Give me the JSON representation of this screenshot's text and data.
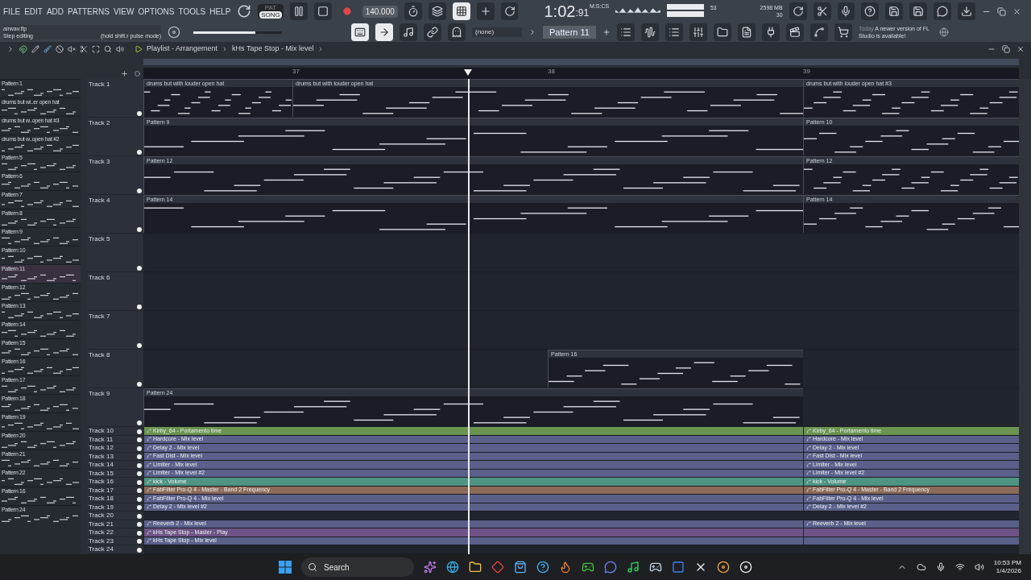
{
  "menu": [
    "FILE",
    "EDIT",
    "ADD",
    "PATTERNS",
    "VIEW",
    "OPTIONS",
    "TOOLS",
    "HELP"
  ],
  "mode": [
    {
      "label": "PAT",
      "selected": false
    },
    {
      "label": "SONG",
      "selected": true
    }
  ],
  "tempo": "140.000",
  "time": {
    "value": "1:02",
    "centiseconds": ":91",
    "unit": "M:S:CS"
  },
  "cpu": {
    "value": "53",
    "memory": "2598 MB",
    "polyphony": "30"
  },
  "hint": {
    "file": "airwav.flp",
    "mode": "Step editing",
    "tip": "(hold shift.r pulse mode)"
  },
  "master_volume": {
    "level": 0.7
  },
  "channel_target": "(none)",
  "pattern_selector": "Pattern 11",
  "news": {
    "date": "Today",
    "text": "A newer version of FL Studio is available!"
  },
  "playlist": {
    "title": "Playlist - Arrangement",
    "breadcrumb": "kHs Tape Stop - Mix level",
    "ruler": [
      "37",
      "38",
      "39"
    ],
    "playhead": {
      "level": 0.371
    },
    "patterns": [
      {
        "name": "Pattern 1",
        "selected": false
      },
      {
        "name": "drums but wi..er open hat",
        "selected": false
      },
      {
        "name": "drums but w..open hat #3",
        "selected": false
      },
      {
        "name": "drums but w..open hat #2",
        "selected": false
      },
      {
        "name": "Pattern 5",
        "selected": false
      },
      {
        "name": "Pattern 6",
        "selected": false
      },
      {
        "name": "Pattern 7",
        "selected": false
      },
      {
        "name": "Pattern 8",
        "selected": false
      },
      {
        "name": "Pattern 9",
        "selected": false
      },
      {
        "name": "Pattern 10",
        "selected": false
      },
      {
        "name": "Pattern 11",
        "selected": true
      },
      {
        "name": "Pattern 12",
        "selected": false
      },
      {
        "name": "Pattern 13",
        "selected": false
      },
      {
        "name": "Pattern 14",
        "selected": false
      },
      {
        "name": "Pattern 15",
        "selected": false
      },
      {
        "name": "Pattern 16",
        "selected": false
      },
      {
        "name": "Pattern 17",
        "selected": false
      },
      {
        "name": "Pattern 18",
        "selected": false
      },
      {
        "name": "Pattern 19",
        "selected": false
      },
      {
        "name": "Pattern 20",
        "selected": false
      },
      {
        "name": "Pattern 21",
        "selected": false
      },
      {
        "name": "Pattern 22",
        "selected": false
      },
      {
        "name": "Pattern 16",
        "selected": false
      },
      {
        "name": "Pattern 24",
        "selected": false
      }
    ],
    "tracks": [
      {
        "name": "Track 1",
        "kind": "pattern",
        "slots": [
          {
            "kind": "start",
            "label": "drums but with louder open hat"
          },
          {
            "kind": "start",
            "label": "drums but with louder open hat"
          },
          {
            "kind": "continue"
          },
          {
            "kind": "start",
            "label": "drums but with louder open hat #3"
          }
        ]
      },
      {
        "name": "Track 2",
        "kind": "pattern",
        "slots": [
          {
            "kind": "start",
            "label": "Pattern 9"
          },
          {
            "kind": "continue"
          },
          {
            "kind": "continue"
          },
          {
            "kind": "start",
            "label": "Pattern 10"
          }
        ]
      },
      {
        "name": "Track 3",
        "kind": "pattern",
        "slots": [
          {
            "kind": "start",
            "label": "Pattern 12"
          },
          {
            "kind": "continue"
          },
          {
            "kind": "continue"
          },
          {
            "kind": "start",
            "label": "Pattern 12"
          }
        ]
      },
      {
        "name": "Track 4",
        "kind": "pattern",
        "slots": [
          {
            "kind": "start",
            "label": "Pattern 14"
          },
          {
            "kind": "continue"
          },
          {
            "kind": "continue"
          },
          {
            "kind": "start",
            "label": "Pattern 14"
          }
        ]
      },
      {
        "name": "Track 5",
        "kind": "pattern"
      },
      {
        "name": "Track 6",
        "kind": "pattern"
      },
      {
        "name": "Track 7",
        "kind": "pattern"
      },
      {
        "name": "Track 8",
        "kind": "pattern",
        "slots": [
          {
            "kind": "empty"
          },
          {
            "kind": "empty"
          },
          {
            "kind": "start",
            "label": "Pattern 16"
          },
          {
            "kind": "empty"
          }
        ]
      },
      {
        "name": "Track 9",
        "kind": "pattern",
        "slots": [
          {
            "kind": "start",
            "label": "Pattern 24"
          },
          {
            "kind": "continue"
          },
          {
            "kind": "continue"
          },
          {
            "kind": "empty"
          }
        ]
      },
      {
        "name": "Track 10",
        "kind": "automation",
        "slots": [
          {
            "kind": "start",
            "label": "Kirby_64 - Portamento time",
            "color": "#6a9450"
          },
          {
            "kind": "continue"
          },
          {
            "kind": "continue"
          },
          {
            "kind": "start",
            "label": "Kirby_64 - Portamento time",
            "color": "#6a9450"
          }
        ]
      },
      {
        "name": "Track 11",
        "kind": "automation",
        "slots": [
          {
            "kind": "start",
            "label": "Hardcore - Mix level",
            "color": "#5a608a"
          },
          {
            "kind": "continue"
          },
          {
            "kind": "continue"
          },
          {
            "kind": "start",
            "label": "Hardcore - Mix level",
            "color": "#5a608a"
          }
        ]
      },
      {
        "name": "Track 12",
        "kind": "automation",
        "slots": [
          {
            "kind": "start",
            "label": "Delay 2 - Mix level",
            "color": "#5a608a"
          },
          {
            "kind": "continue"
          },
          {
            "kind": "continue"
          },
          {
            "kind": "start",
            "label": "Delay 2 - Mix level",
            "color": "#5a608a"
          }
        ]
      },
      {
        "name": "Track 13",
        "kind": "automation",
        "slots": [
          {
            "kind": "start",
            "label": "Fast Dist - Mix level",
            "color": "#5a608a"
          },
          {
            "kind": "continue"
          },
          {
            "kind": "continue"
          },
          {
            "kind": "start",
            "label": "Fast Dist - Mix level",
            "color": "#5a608a"
          }
        ]
      },
      {
        "name": "Track 14",
        "kind": "automation",
        "slots": [
          {
            "kind": "start",
            "label": "Limiter - Mix level",
            "color": "#5a608a"
          },
          {
            "kind": "continue"
          },
          {
            "kind": "continue"
          },
          {
            "kind": "start",
            "label": "Limiter - Mix level",
            "color": "#5a608a"
          }
        ]
      },
      {
        "name": "Track 15",
        "kind": "automation",
        "slots": [
          {
            "kind": "start",
            "label": "Limiter - Mix level #2",
            "color": "#5a608a"
          },
          {
            "kind": "continue"
          },
          {
            "kind": "continue"
          },
          {
            "kind": "start",
            "label": "Limiter - Mix level #2",
            "color": "#5a608a"
          }
        ]
      },
      {
        "name": "Track 16",
        "kind": "automation",
        "slots": [
          {
            "kind": "start",
            "label": "kick - Volume",
            "color": "#4e9482"
          },
          {
            "kind": "continue"
          },
          {
            "kind": "continue"
          },
          {
            "kind": "start",
            "label": "kick - Volume",
            "color": "#4e9482"
          }
        ]
      },
      {
        "name": "Track 17",
        "kind": "automation",
        "slots": [
          {
            "kind": "start",
            "label": "FabFilter Pro-Q 4 - Master - Band 2 Frequency",
            "color": "#8c6a58"
          },
          {
            "kind": "continue"
          },
          {
            "kind": "continue"
          },
          {
            "kind": "start",
            "label": "FabFilter Pro-Q 4 - Master - Band 2 Frequency",
            "color": "#8c6a58"
          }
        ]
      },
      {
        "name": "Track 18",
        "kind": "automation",
        "slots": [
          {
            "kind": "start",
            "label": "FabFilter Pro-Q 4 - Mix level",
            "color": "#5a608a"
          },
          {
            "kind": "continue"
          },
          {
            "kind": "continue"
          },
          {
            "kind": "start",
            "label": "FabFilter Pro-Q 4 - Mix level",
            "color": "#5a608a"
          }
        ]
      },
      {
        "name": "Track 19",
        "kind": "automation",
        "slots": [
          {
            "kind": "start",
            "label": "Delay 2 - Mix level #2",
            "color": "#5a608a"
          },
          {
            "kind": "continue"
          },
          {
            "kind": "continue"
          },
          {
            "kind": "start",
            "label": "Delay 2 - Mix level #2",
            "color": "#5a608a"
          }
        ]
      },
      {
        "name": "Track 20",
        "kind": "automation"
      },
      {
        "name": "Track 21",
        "kind": "automation",
        "slots": [
          {
            "kind": "start",
            "label": "Reeverb 2 - Mix level",
            "color": "#5a608a"
          },
          {
            "kind": "continue"
          },
          {
            "kind": "continue"
          },
          {
            "kind": "start",
            "label": "Reeverb 2 - Mix level",
            "color": "#5a608a"
          }
        ]
      },
      {
        "name": "Track 22",
        "kind": "automation",
        "slots": [
          {
            "kind": "start",
            "label": "kHs Tape Stop - Master - Play",
            "color": "#6e5486"
          },
          {
            "kind": "continue"
          },
          {
            "kind": "continue"
          },
          {
            "kind": "start",
            "color": "#6e5486"
          }
        ]
      },
      {
        "name": "Track 23",
        "kind": "automation",
        "slots": [
          {
            "kind": "start",
            "label": "kHs Tape Stop - Mix level",
            "color": "#5a608a"
          },
          {
            "kind": "continue"
          },
          {
            "kind": "continue"
          },
          {
            "kind": "start",
            "color": "#5a608a"
          }
        ]
      },
      {
        "name": "Track 24",
        "kind": "automation"
      }
    ]
  },
  "taskbar": {
    "search": "Search",
    "time": "10:53 PM",
    "date": "1/4/2026"
  }
}
